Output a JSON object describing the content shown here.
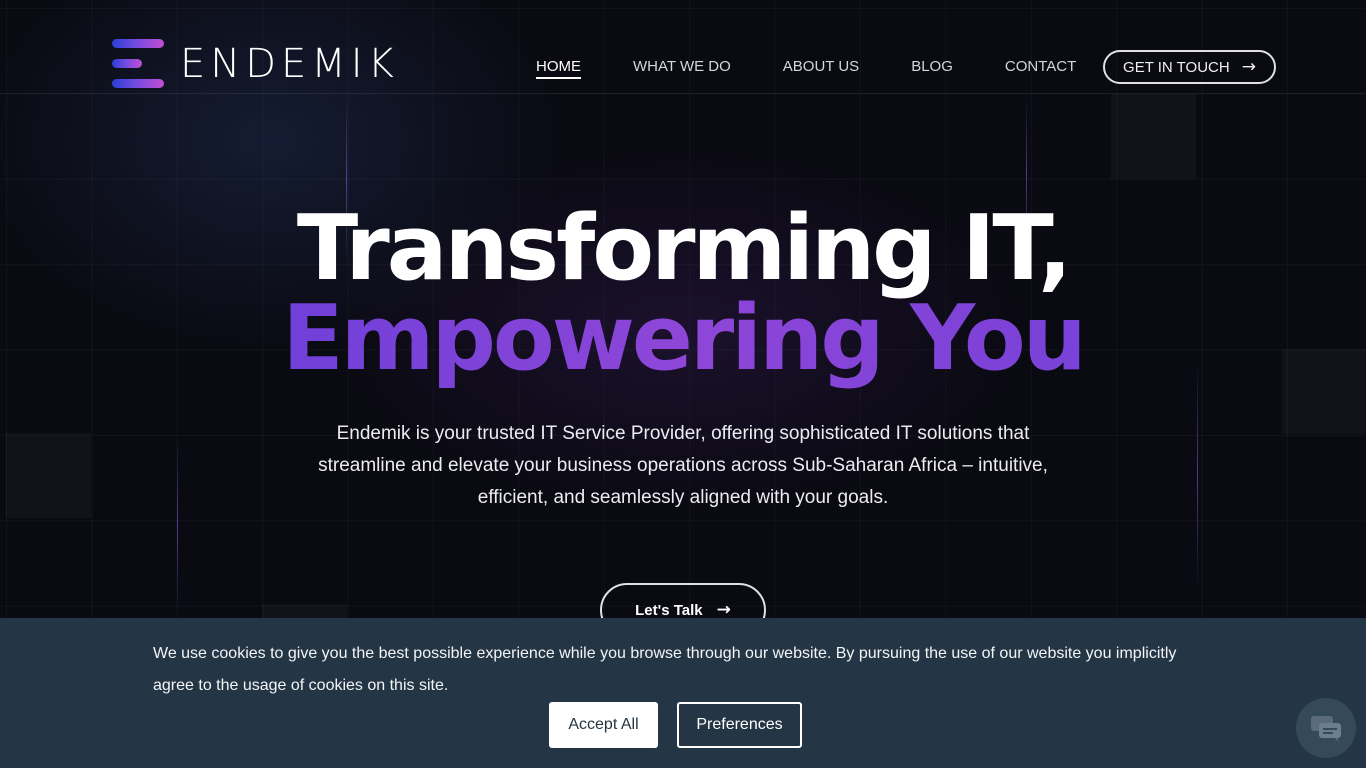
{
  "brand": {
    "name": "ENDEMIK",
    "logo_icon": "endemik-logo-mark"
  },
  "nav": {
    "items": [
      {
        "label": "HOME",
        "active": true
      },
      {
        "label": "WHAT WE DO"
      },
      {
        "label": "ABOUT US"
      },
      {
        "label": "BLOG"
      },
      {
        "label": "CONTACT"
      }
    ],
    "cta_label": "GET IN TOUCH",
    "cta_icon": "arrow-right-icon"
  },
  "hero": {
    "title_line1": "Transforming IT,",
    "title_line2": "Empowering You",
    "description": "Endemik is your trusted IT Service Provider, offering sophisticated IT solutions that streamline and elevate your business operations across Sub-Saharan Africa – intuitive, efficient, and seamlessly aligned with your goals.",
    "button_label": "Let's Talk",
    "button_icon": "arrow-right-icon"
  },
  "cookie_banner": {
    "text": "We use cookies to give you the best possible experience while you browse through our website. By pursuing the use of our website you implicitly agree to the usage of cookies on this site.",
    "accept_label": "Accept All",
    "preferences_label": "Preferences"
  },
  "chat_widget": {
    "icon": "chat-bubble-icon"
  },
  "colors": {
    "background": "#0a0a12",
    "accent_gradient_start": "#5a3bd8",
    "accent_gradient_end": "#8e46d8",
    "cookie_banner_bg": "#243645"
  }
}
